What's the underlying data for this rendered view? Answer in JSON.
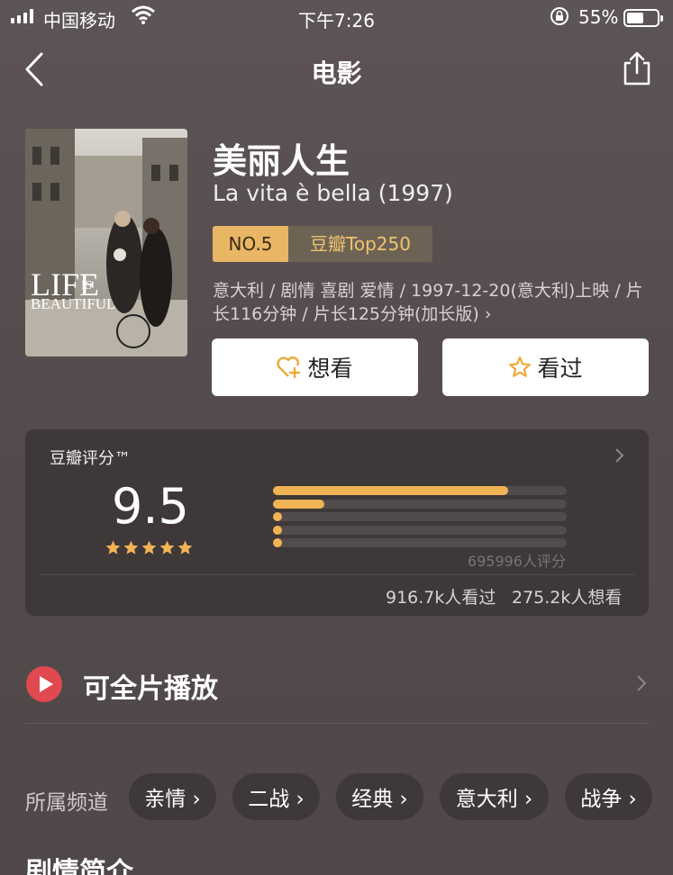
{
  "status_bar": {
    "carrier": "中国移动",
    "time": "下午7:26",
    "battery_pct": "55%",
    "battery_level": 0.55
  },
  "nav": {
    "title": "电影"
  },
  "movie": {
    "title": "美丽人生",
    "original_title": "La vita è bella (1997)",
    "rank_no": "NO.5",
    "rank_list": "豆瓣Top250",
    "meta": "意大利 / 剧情 喜剧 爱情 / 1997-12-20(意大利)上映 / 片长116分钟 / 片长125分钟(加长版) ›",
    "poster": {
      "line1": "LIFE",
      "line2": "IS",
      "line3": "BEAUTIFUL"
    }
  },
  "actions": {
    "want": "想看",
    "seen": "看过"
  },
  "rating": {
    "label": "豆瓣评分™",
    "score": "9.5",
    "stars_filled": 5,
    "distribution": [
      {
        "stars": 5,
        "fraction": 0.8
      },
      {
        "stars": 4,
        "fraction": 0.175
      },
      {
        "stars": 3,
        "fraction": 0.03
      },
      {
        "stars": 2,
        "fraction": 0.03
      },
      {
        "stars": 1,
        "fraction": 0.03
      }
    ],
    "rating_count": "695996人评分",
    "seen_count": "916.7k人看过",
    "want_count": "275.2k人想看"
  },
  "play": {
    "label": "可全片播放"
  },
  "channels": {
    "label": "所属频道",
    "items": [
      "亲情 ›",
      "二战 ›",
      "经典 ›",
      "意大利 ›",
      "战争 ›"
    ]
  },
  "synopsis_title": "剧情简介",
  "colors": {
    "accent": "#f1b455",
    "play_red": "#e0494f",
    "card_bg": "#3e3839"
  }
}
